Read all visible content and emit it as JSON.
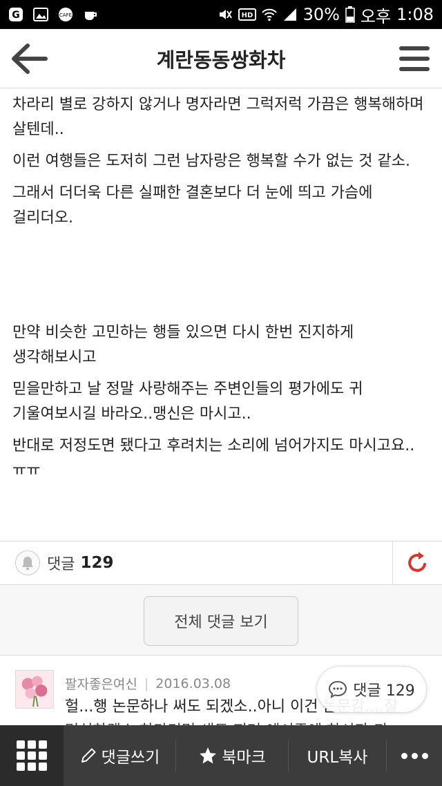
{
  "status": {
    "battery": "30%",
    "ampm": "오후",
    "time": "1:08"
  },
  "header": {
    "title": "계란동동쌍화차"
  },
  "article": {
    "paragraphs": [
      "차라리 별로 강하지 않거나 명자라면 그럭저럭 가끔은 행복해하며 살텐데..",
      "이런 여행들은 도저히 그런 남자랑은 행복할 수가 없는 것 같소.",
      "그래서 더더욱 다른 실패한 결혼보다 더 눈에 띄고 가슴에 걸리더오.",
      "만약 비슷한 고민하는 행들 있으면 다시 한번 진지하게 생각해보시고",
      "믿을만하고 날 정말 사랑해주는 주변인들의 평가에도 귀 기울여보시길 바라오..맹신은 마시고..",
      "반대로 저정도면 됐다고 후려치는 소리에 넘어가지도 마시고요..ㅠㅠ"
    ]
  },
  "comments_bar": {
    "label": "댓글",
    "count": "129"
  },
  "all_comments_button": "전체 댓글 보기",
  "comment": {
    "author": "팔자좋은여신",
    "date": "2016.03.08",
    "text": "헐...행 논문하나 써도 되겠소..아니 이건 논문감....잘",
    "text2": "명심하겠소 하마터면 새도 지러 예시주에 하시과 되"
  },
  "float_comment": {
    "label": "댓글 129"
  },
  "bottom_bar": {
    "write": "댓글쓰기",
    "bookmark": "북마크",
    "url_copy": "URL복사"
  },
  "colors": {
    "accent_red": "#d9342b",
    "bottom_bar": "#3c3c3c"
  }
}
